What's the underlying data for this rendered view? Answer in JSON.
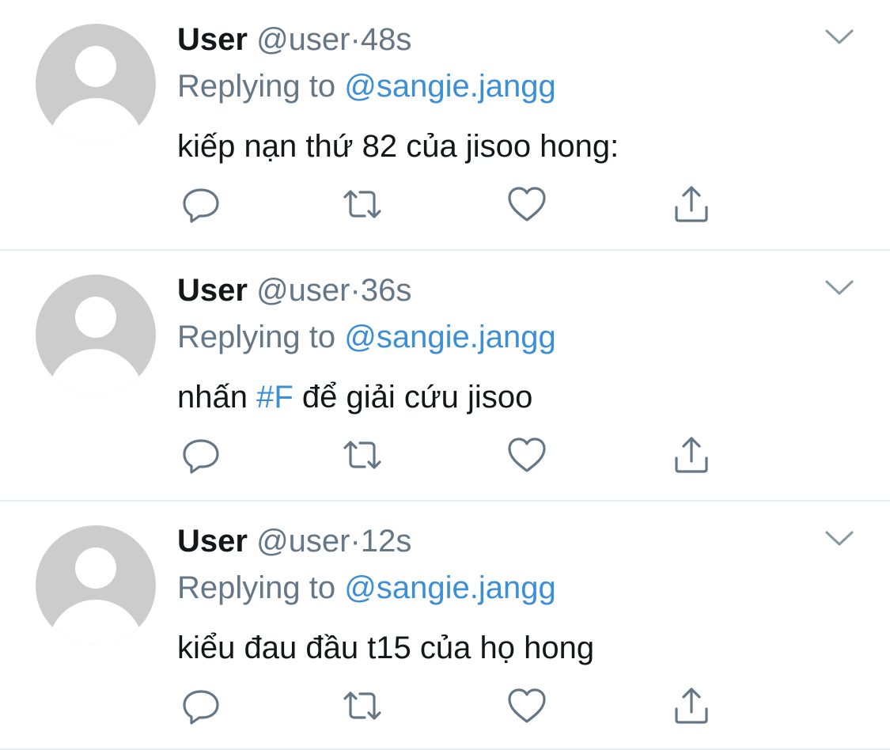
{
  "colors": {
    "name": "#14171a",
    "secondary": "#657786",
    "link": "#3b8fd6",
    "icon": "#657786",
    "divider": "#e6ecf0",
    "avatar_bg": "#cccccc"
  },
  "icons": {
    "reply": "reply-icon",
    "retweet": "retweet-icon",
    "like": "heart-icon",
    "share": "share-icon",
    "menu": "chevron-down-icon",
    "avatar": "default-avatar-icon"
  },
  "tweets": [
    {
      "name": "User",
      "handle": "@user",
      "dot": "·",
      "time": "48s",
      "replying_prefix": "Replying to",
      "replying_to": "@sangie.jangg",
      "text": "kiếp nạn thứ 82 của jisoo hong:"
    },
    {
      "name": "User",
      "handle": "@user",
      "dot": "·",
      "time": "36s",
      "replying_prefix": "Replying to",
      "replying_to": "@sangie.jangg",
      "text_before": "nhấn",
      "hashtag": "#F",
      "text_after": "để giải cứu jisoo"
    },
    {
      "name": "User",
      "handle": "@user",
      "dot": "·",
      "time": "12s",
      "replying_prefix": "Replying to",
      "replying_to": "@sangie.jangg",
      "text": "kiểu đau đầu t15 của họ hong"
    }
  ]
}
